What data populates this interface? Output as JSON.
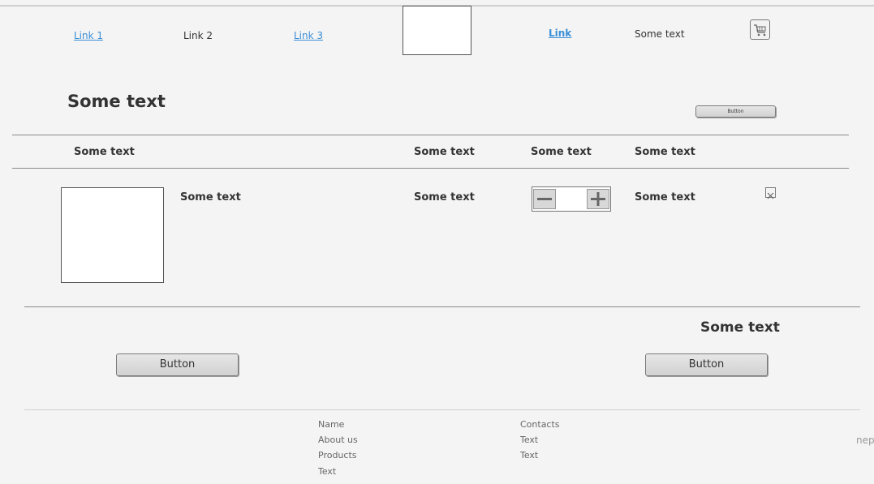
{
  "nav": {
    "link1": "Link 1",
    "link2": "Link 2",
    "link3": "Link 3",
    "link4": "Link",
    "text": "Some text",
    "cart_icon": "cart-icon"
  },
  "header": {
    "title": "Some text",
    "small_button": "Button"
  },
  "table": {
    "headers": [
      "Some text",
      "Some text",
      "Some text",
      "Some text"
    ],
    "row": {
      "name": "Some text",
      "price": "Some text",
      "quantity_minus_icon": "minus-icon",
      "quantity_plus_icon": "plus-icon",
      "total": "Some text",
      "remove_icon": "close-icon"
    }
  },
  "summary": {
    "total": "Some text",
    "left_button": "Button",
    "right_button": "Button"
  },
  "footer": {
    "col1": [
      "Name",
      "About us",
      "Products",
      "Text"
    ],
    "col2": [
      "Contacts",
      "Text",
      "Text"
    ],
    "edge_text": "nep"
  }
}
